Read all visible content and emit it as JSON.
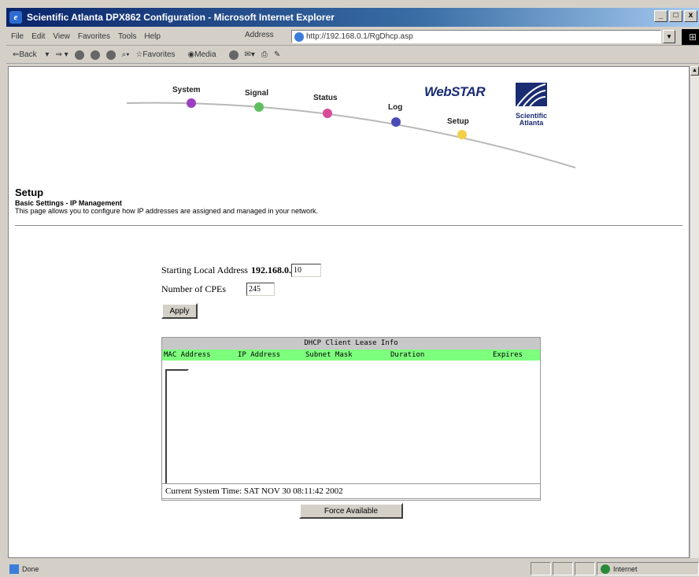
{
  "window": {
    "title": "Scientific Atlanta DPX862 Configuration - Microsoft Internet Explorer",
    "controls": [
      "_",
      "□",
      "x"
    ]
  },
  "menu": {
    "items": [
      "File",
      "Edit",
      "View",
      "Favorites",
      "Tools",
      "Help"
    ],
    "address_label": "Address",
    "address_url": "http://192.168.0.1/RgDhcp.asp"
  },
  "toolbar": {
    "back": "Back",
    "favorites": "Favorites",
    "media": "Media"
  },
  "nav": {
    "items": [
      "System",
      "Signal",
      "Status",
      "Log",
      "Setup"
    ],
    "colors": [
      "#9b3fbf",
      "#5fbf5f",
      "#d84a9a",
      "#4b4bb8",
      "#f2d04a"
    ],
    "brand": "WebSTAR",
    "company": "Scientific Atlanta"
  },
  "page": {
    "title": "Setup",
    "subtitle": "Basic Settings - IP Management",
    "description": "This page allows you to configure how IP addresses are assigned and managed in your network."
  },
  "form": {
    "start_label": "Starting Local Address",
    "start_prefix": "192.168.0.",
    "start_value": "10",
    "cpe_label": "Number of CPEs",
    "cpe_value": "245",
    "apply_label": "Apply"
  },
  "dhcp": {
    "title": "DHCP Client Lease Info",
    "columns": [
      "MAC Address",
      "IP Address",
      "Subnet Mask",
      "Duration",
      "Expires"
    ],
    "system_time": "Current System Time: SAT NOV 30 08:11:42 2002",
    "force_label": "Force Available"
  },
  "status": {
    "text": "Done",
    "zone": "Internet"
  }
}
